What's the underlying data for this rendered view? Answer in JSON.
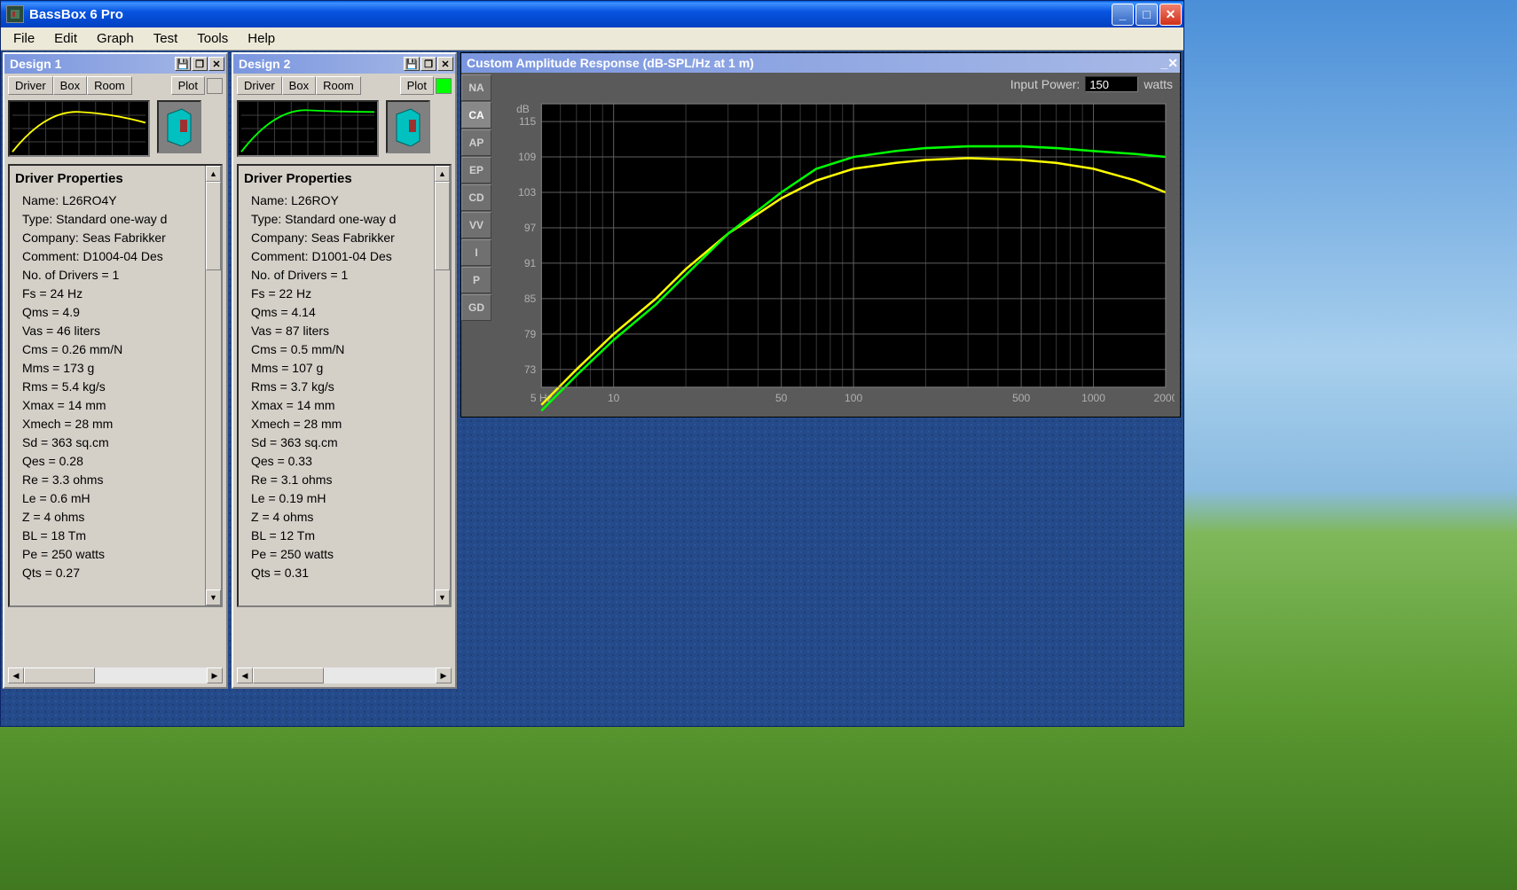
{
  "app": {
    "title": "BassBox 6 Pro"
  },
  "menu": {
    "items": [
      "File",
      "Edit",
      "Graph",
      "Test",
      "Tools",
      "Help"
    ]
  },
  "designs": [
    {
      "title": "Design 1",
      "tabs": [
        "Driver",
        "Box",
        "Room"
      ],
      "plot_label": "Plot",
      "color": "#ffff00",
      "props_header": "Driver Properties",
      "props": [
        "Name: L26RO4Y",
        "Type: Standard one-way d",
        "Company: Seas Fabrikker",
        "Comment: D1004-04  Des",
        "No. of Drivers = 1",
        "Fs =  24 Hz",
        "Qms =  4.9",
        "Vas =  46 liters",
        "Cms =  0.26 mm/N",
        "Mms =  173 g",
        "Rms =  5.4 kg/s",
        "Xmax =  14 mm",
        "Xmech =  28 mm",
        "Sd =  363 sq.cm",
        "Qes =  0.28",
        "Re =  3.3 ohms",
        "Le =  0.6 mH",
        "Z =  4 ohms",
        "BL =  18 Tm",
        "Pe =  250 watts",
        "Qts =  0.27"
      ]
    },
    {
      "title": "Design 2",
      "tabs": [
        "Driver",
        "Box",
        "Room"
      ],
      "plot_label": "Plot",
      "color": "#00ff00",
      "props_header": "Driver Properties",
      "props": [
        "Name: L26ROY",
        "Type: Standard one-way d",
        "Company: Seas Fabrikker",
        "Comment: D1001-04  Des",
        "No. of Drivers = 1",
        "Fs =  22 Hz",
        "Qms =  4.14",
        "Vas =  87 liters",
        "Cms =  0.5 mm/N",
        "Mms =  107 g",
        "Rms =  3.7 kg/s",
        "Xmax =  14 mm",
        "Xmech =  28 mm",
        "Sd =  363 sq.cm",
        "Qes =  0.33",
        "Re =  3.1 ohms",
        "Le =  0.19 mH",
        "Z =  4 ohms",
        "BL =  12 Tm",
        "Pe =  250 watts",
        "Qts =  0.31"
      ]
    }
  ],
  "chart_window": {
    "title": "Custom Amplitude Response (dB-SPL/Hz at 1 m)",
    "tabs": [
      "NA",
      "CA",
      "AP",
      "EP",
      "CD",
      "VV",
      "I",
      "P",
      "GD"
    ],
    "active_tab": "CA",
    "input_power_label": "Input Power:",
    "input_power_value": "150",
    "input_power_unit": "watts"
  },
  "chart_data": {
    "type": "line",
    "title": "Custom Amplitude Response (dB-SPL/Hz at 1 m)",
    "xlabel": "Hz",
    "ylabel": "dB",
    "x_scale": "log",
    "xlim": [
      5,
      2000
    ],
    "ylim": [
      70,
      118
    ],
    "y_ticks": [
      73,
      79,
      85,
      91,
      97,
      103,
      109,
      115
    ],
    "x_ticks": [
      5,
      10,
      50,
      100,
      500,
      1000,
      2000
    ],
    "x_tick_labels": [
      "5 Hz",
      "10",
      "50",
      "100",
      "500",
      "1000",
      "2000"
    ],
    "series": [
      {
        "name": "Design 1",
        "color": "#ffff00",
        "x": [
          5,
          7,
          10,
          15,
          20,
          30,
          50,
          70,
          100,
          150,
          200,
          300,
          500,
          700,
          1000,
          1500,
          2000
        ],
        "y": [
          67,
          73,
          79,
          85,
          90,
          96,
          102,
          105,
          107,
          108,
          108.5,
          108.8,
          108.5,
          108,
          107,
          105,
          103
        ]
      },
      {
        "name": "Design 2",
        "color": "#00ff00",
        "x": [
          5,
          7,
          10,
          15,
          20,
          30,
          50,
          70,
          100,
          150,
          200,
          300,
          500,
          700,
          1000,
          1500,
          2000
        ],
        "y": [
          66,
          72,
          78,
          84,
          89,
          96,
          103,
          107,
          109,
          110,
          110.5,
          110.8,
          110.8,
          110.5,
          110,
          109.5,
          109
        ]
      }
    ]
  }
}
